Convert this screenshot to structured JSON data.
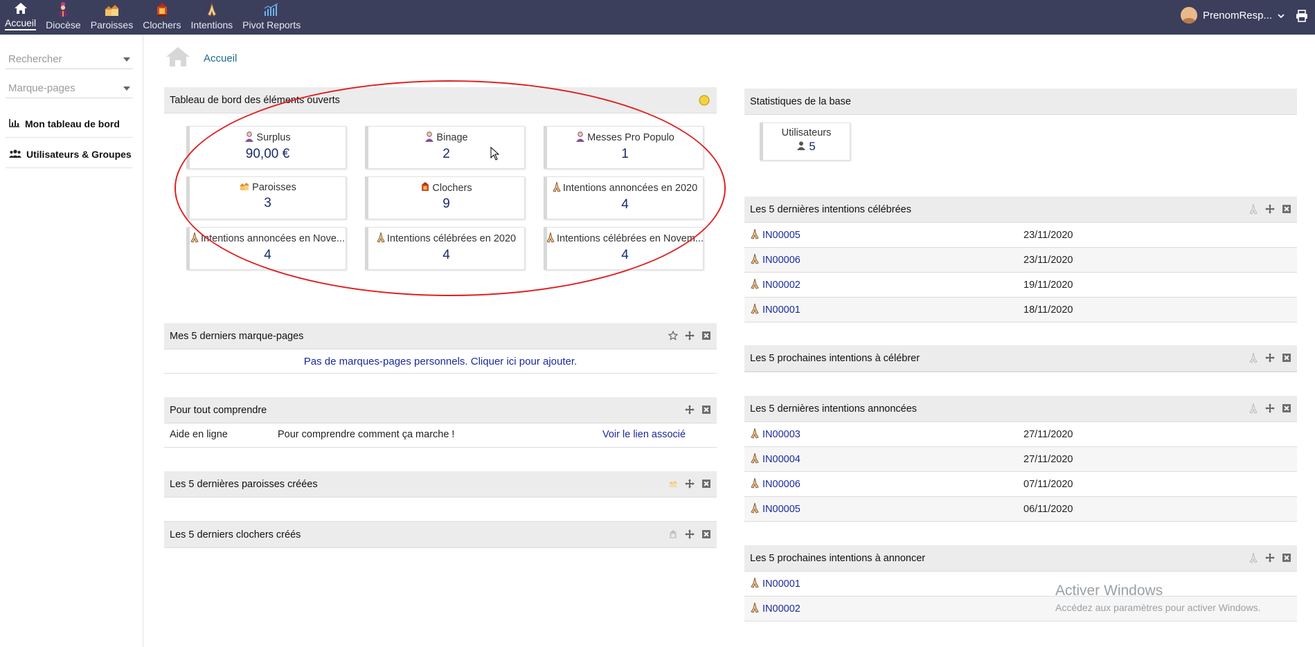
{
  "topnav": {
    "items": [
      {
        "label": "Accueil",
        "icon": "home-icon",
        "active": true
      },
      {
        "label": "Diocèse",
        "icon": "bishop-icon"
      },
      {
        "label": "Paroisses",
        "icon": "parish-icon"
      },
      {
        "label": "Clochers",
        "icon": "belltower-icon"
      },
      {
        "label": "Intentions",
        "icon": "praying-hands-icon"
      },
      {
        "label": "Pivot Reports",
        "icon": "bar-chart-icon"
      }
    ],
    "user_name": "PrenomResp..."
  },
  "sidebar": {
    "search_placeholder": "Rechercher",
    "bookmarks_placeholder": "Marque-pages",
    "links": [
      {
        "label": "Mon tableau de bord",
        "icon": "chart-icon"
      },
      {
        "label": "Utilisateurs & Groupes",
        "icon": "users-icon"
      }
    ]
  },
  "breadcrumb": {
    "label": "Accueil"
  },
  "dashboard": {
    "title": "Tableau de bord des éléments ouverts",
    "boxes": [
      {
        "label": "Surplus",
        "value": "90,00 €",
        "icon": "person-icon"
      },
      {
        "label": "Binage",
        "value": "2",
        "icon": "person-icon"
      },
      {
        "label": "Messes Pro Populo",
        "value": "1",
        "icon": "person-icon"
      },
      {
        "label": "Paroisses",
        "value": "3",
        "icon": "parish-icon"
      },
      {
        "label": "Clochers",
        "value": "9",
        "icon": "belltower-icon"
      },
      {
        "label": "Intentions annoncées en 2020",
        "value": "4",
        "icon": "praying-hands-icon"
      },
      {
        "label": "Intentions annoncées en Nove...",
        "value": "4",
        "icon": "praying-hands-icon"
      },
      {
        "label": "Intentions célébrées en 2020",
        "value": "4",
        "icon": "praying-hands-icon"
      },
      {
        "label": "Intentions célébrées en Novem...",
        "value": "4",
        "icon": "praying-hands-icon"
      }
    ]
  },
  "bookmarks": {
    "title": "Mes 5 derniers marque-pages",
    "empty_text": "Pas de marques-pages personnels. Cliquer ici pour ajouter."
  },
  "help": {
    "title": "Pour tout comprendre",
    "col1": "Aide en ligne",
    "col2": "Pour comprendre comment ça marche !",
    "col3": "Voir le lien associé"
  },
  "parishes": {
    "title": "Les 5 dernières paroisses créées"
  },
  "towers": {
    "title": "Les 5 derniers clochers créés"
  },
  "stats": {
    "title": "Statistiques de la base",
    "users_label": "Utilisateurs",
    "users_value": "5"
  },
  "celebrated": {
    "title": "Les 5 dernières intentions célébrées",
    "rows": [
      {
        "ref": "IN00005",
        "date": "23/11/2020"
      },
      {
        "ref": "IN00006",
        "date": "23/11/2020"
      },
      {
        "ref": "IN00002",
        "date": "19/11/2020"
      },
      {
        "ref": "IN00001",
        "date": "18/11/2020"
      }
    ]
  },
  "next_celebrate": {
    "title": "Les 5 prochaines intentions à célébrer"
  },
  "announced": {
    "title": "Les 5 dernières intentions annoncées",
    "rows": [
      {
        "ref": "IN00003",
        "date": "27/11/2020"
      },
      {
        "ref": "IN00004",
        "date": "27/11/2020"
      },
      {
        "ref": "IN00006",
        "date": "07/11/2020"
      },
      {
        "ref": "IN00005",
        "date": "06/11/2020"
      }
    ]
  },
  "next_announce": {
    "title": "Les 5 prochaines intentions à annoncer",
    "rows": [
      {
        "ref": "IN00001"
      },
      {
        "ref": "IN00002"
      }
    ]
  },
  "watermark": {
    "line1": "Activer Windows",
    "line2": "Accédez aux paramètres pour activer Windows."
  }
}
